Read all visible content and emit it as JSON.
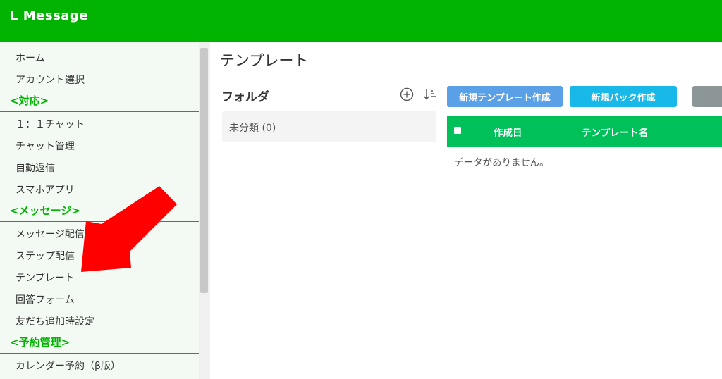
{
  "app": {
    "title": "L Message"
  },
  "sidebar": {
    "groups": [
      {
        "section": "",
        "items": [
          "ホーム",
          "アカウント選択"
        ]
      },
      {
        "section": "<対応>",
        "items": [
          "１：１チャット",
          "チャット管理",
          "自動返信",
          "スマホアプリ"
        ]
      },
      {
        "section": "<メッセージ>",
        "items": [
          "メッセージ配信",
          "ステップ配信",
          "テンプレート",
          "回答フォーム",
          "友だち追加時設定"
        ]
      },
      {
        "section": "<予約管理>",
        "items": [
          "カレンダー予約（β版）"
        ]
      }
    ]
  },
  "main": {
    "page_title": "テンプレート",
    "folders": {
      "title": "フォルダ",
      "add_icon": "plus-circle-icon",
      "sort_icon": "sort-icon",
      "items": [
        {
          "label": "未分類 (0)"
        }
      ]
    },
    "toolbar": {
      "new_template_label": "新規テンプレート作成",
      "new_pack_label": "新規パック作成",
      "extra_label": ""
    },
    "table": {
      "columns": [
        "作成日",
        "テンプレート名"
      ],
      "empty_message": "データがありません。"
    }
  },
  "annotation": {
    "type": "arrow",
    "color": "#ff0000",
    "points_to": "テンプレート"
  },
  "colors": {
    "header": "#00b300",
    "sidebar_bg": "#f3faf3",
    "section": "#00b300",
    "table_header": "#00c05a",
    "btn_new_template": "#5aa0e6",
    "btn_new_pack": "#18b8e8"
  }
}
